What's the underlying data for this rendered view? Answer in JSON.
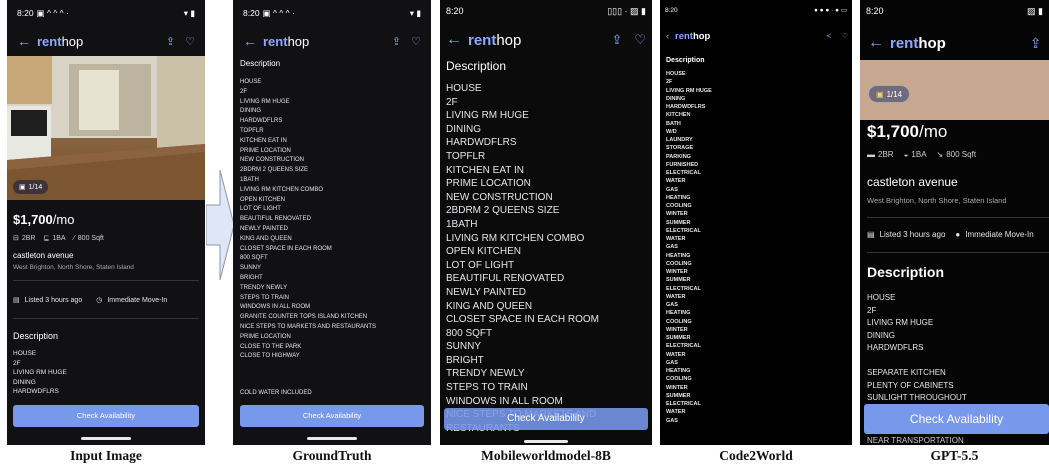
{
  "captions": [
    "Input Image",
    "GroundTruth",
    "Mobileworldmodel-8B",
    "Code2World",
    "GPT-5.5"
  ],
  "brand": {
    "prefix": "rent",
    "suffix": "hop"
  },
  "status": {
    "time": "8:20",
    "status_icons": "▣ ^ ^ ^ ·",
    "battery": "▾ ▮"
  },
  "listing": {
    "photo_count": "1/14",
    "price": "$1,700",
    "price_unit": "/mo",
    "beds": "2BR",
    "baths": "1BA",
    "sqft": "800 Sqft",
    "address": "castleton avenue",
    "neighborhood": "West Brighton, North Shore, Staten Island",
    "listed": "Listed 3 hours ago",
    "move_in": "Immediate Move-In",
    "description_heading": "Description",
    "cta": "Check Availability"
  },
  "p1_desc": [
    "HOUSE",
    "2F",
    "LIVING RM HUGE",
    "DINING",
    "HARDWDFLRS"
  ],
  "p2_desc": [
    "HOUSE",
    "2F",
    "LIVING RM HUGE",
    "DINING",
    "HARDWDFLRS",
    "TOPFLR",
    "KITCHEN EAT IN",
    "PRIME LOCATION",
    "NEW CONSTRUCTION",
    "2BDRM 2 QUEENS SIZE",
    "1BATH",
    "LIVING RM KITCHEN COMBO",
    "OPEN KITCHEN",
    "LOT OF LIGHT",
    "BEAUTIFUL RENOVATED",
    "NEWLY PAINTED",
    "KING AND QUEEN",
    "CLOSET SPACE IN EACH ROOM",
    "800 SQFT",
    "SUNNY",
    "BRIGHT",
    "TRENDY NEWLY",
    "STEPS TO TRAIN",
    "WINDOWS IN ALL ROOM",
    "GRANITE COUNTER TOPS ISLAND KITCHEN",
    "NICE STEPS TO MARKETS AND RESTAURANTS",
    "PRIME LOCATION",
    "CLOSE TO THE PARK",
    "CLOSE TO HIGHWAY"
  ],
  "p2_extra": "COLD WATER INCLUDED",
  "p3_desc": [
    "HOUSE",
    "2F",
    "LIVING RM HUGE",
    "DINING",
    "HARDWDFLRS",
    "TOPFLR",
    "KITCHEN EAT IN",
    "PRIME LOCATION",
    "NEW CONSTRUCTION",
    "2BDRM 2 QUEENS SIZE",
    "1BATH",
    "LIVING RM KITCHEN COMBO",
    "OPEN KITCHEN",
    "LOT OF LIGHT",
    "BEAUTIFUL RENOVATED",
    "NEWLY PAINTED",
    "KING AND QUEEN",
    "CLOSET SPACE IN EACH ROOM",
    "800 SQFT",
    "SUNNY",
    "BRIGHT",
    "TRENDY NEWLY",
    "STEPS TO TRAIN",
    "WINDOWS IN ALL ROOM",
    "NICE STEPS TO MARKETS AND",
    "RESTAURANTS"
  ],
  "p4_desc": [
    "HOUSE",
    "2F",
    "LIVING RM HUGE",
    "DINING",
    "HARDWDFLRS",
    "KITCHEN",
    "BATH",
    "W/D",
    "LAUNDRY",
    "STORAGE",
    "PARKING",
    "FURNISHED",
    "ELECTRICAL",
    "WATER",
    "GAS",
    "HEATING",
    "COOLING",
    "WINTER",
    "SUMMER",
    "ELECTRICAL",
    "WATER",
    "GAS",
    "HEATING",
    "COOLING",
    "WINTER",
    "SUMMER",
    "ELECTRICAL",
    "WATER",
    "GAS",
    "HEATING",
    "COOLING",
    "WINTER",
    "SUMMER",
    "ELECTRICAL",
    "WATER",
    "GAS",
    "HEATING",
    "COOLING",
    "WINTER",
    "SUMMER",
    "ELECTRICAL",
    "WATER",
    "GAS"
  ],
  "p5_desc": [
    "HOUSE",
    "2F",
    "LIVING RM HUGE",
    "DINING",
    "HARDWDFLRS",
    "",
    "SEPARATE KITCHEN",
    "PLENTY OF CABINETS",
    "SUNLIGHT THROUGHOUT"
  ],
  "p5_tail": "NEAR TRANSPORTATION"
}
